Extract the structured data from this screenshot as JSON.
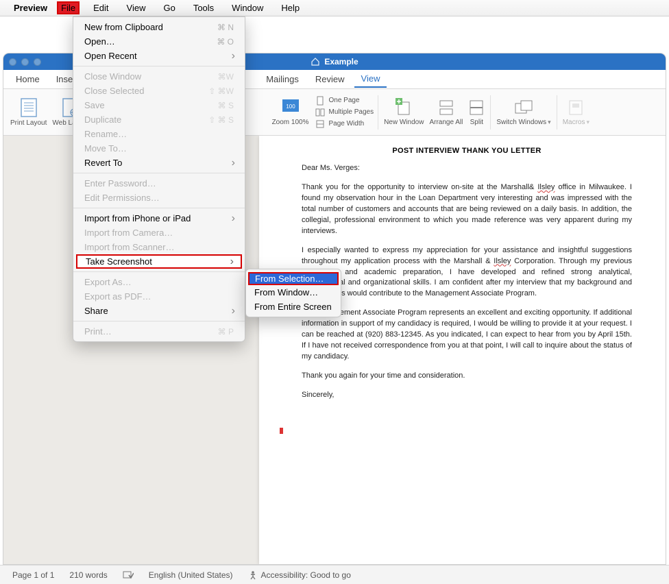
{
  "menubar": {
    "app_name": "Preview",
    "items": [
      "File",
      "Edit",
      "View",
      "Go",
      "Tools",
      "Window",
      "Help"
    ]
  },
  "file_menu": {
    "new_from_clipboard": "New from Clipboard",
    "new_from_clipboard_sc": "⌘ N",
    "open": "Open…",
    "open_sc": "⌘ O",
    "open_recent": "Open Recent",
    "close_window": "Close Window",
    "close_window_sc": "⌘W",
    "close_selected": "Close Selected",
    "close_selected_sc": "⇧ ⌘W",
    "save": "Save",
    "save_sc": "⌘ S",
    "duplicate": "Duplicate",
    "duplicate_sc": "⇧ ⌘ S",
    "rename": "Rename…",
    "move_to": "Move To…",
    "revert_to": "Revert To",
    "enter_password": "Enter Password…",
    "edit_permissions": "Edit Permissions…",
    "import_iphone": "Import from iPhone or iPad",
    "import_camera": "Import from Camera…",
    "import_scanner": "Import from Scanner…",
    "take_screenshot": "Take Screenshot",
    "export_as": "Export As…",
    "export_pdf": "Export as PDF…",
    "share": "Share",
    "print": "Print…",
    "print_sc": "⌘ P"
  },
  "submenu": {
    "from_selection": "From Selection…",
    "from_window": "From Window…",
    "from_entire_screen": "From Entire Screen"
  },
  "window": {
    "title": "Example"
  },
  "ribbon_tabs": [
    "Home",
    "Insert",
    "Mailings",
    "Review",
    "View"
  ],
  "ribbon": {
    "print_layout": "Print Layout",
    "web_layout": "Web Layout",
    "zoom": "Zoom",
    "zoom_pct": "100%",
    "one_page": "One Page",
    "multiple_pages": "Multiple Pages",
    "page_width": "Page Width",
    "new_window": "New Window",
    "arrange_all": "Arrange All",
    "split": "Split",
    "switch_windows": "Switch Windows",
    "macros": "Macros"
  },
  "document": {
    "title": "POST INTERVIEW THANK YOU LETTER",
    "greeting": "Dear Ms. Verges:",
    "p1a": "Thank you for the opportunity to interview on-site at the Marshall& ",
    "p1_sq1": "Ilsley",
    "p1b": " office in Milwaukee. I found my observation hour in the Loan Department very interesting and was impressed with the total number of customers and accounts that are being reviewed on a daily basis. In addition, the collegial, professional environment to which you made reference was very apparent during my interviews.",
    "p2a": "I especially wanted to express my appreciation for your assistance and insightful suggestions throughout my application process with the Marshall & ",
    "p2_sq1": "Ilsley",
    "p2b": " Corporation. Through my previous experience and academic preparation, I have developed and refined strong analytical, interpersonal and organizational skills. I am confident after my interview that my background and qualifications would contribute to the Management Associate Program.",
    "p3": "The Management Associate Program represents an excellent and exciting opportunity. If additional information in support of my candidacy is required, I would be willing to provide it at your request. I can be reached at (920) 883-12345. As you indicated, I can expect to hear from you by April 15th. If I have not received correspondence from you at that point, I will call to inquire about the status of my candidacy.",
    "p4": "Thank you again for your time and consideration.",
    "closing": "Sincerely,"
  },
  "statusbar": {
    "page": "Page 1 of 1",
    "words": "210 words",
    "language": "English (United States)",
    "accessibility": "Accessibility: Good to go"
  }
}
